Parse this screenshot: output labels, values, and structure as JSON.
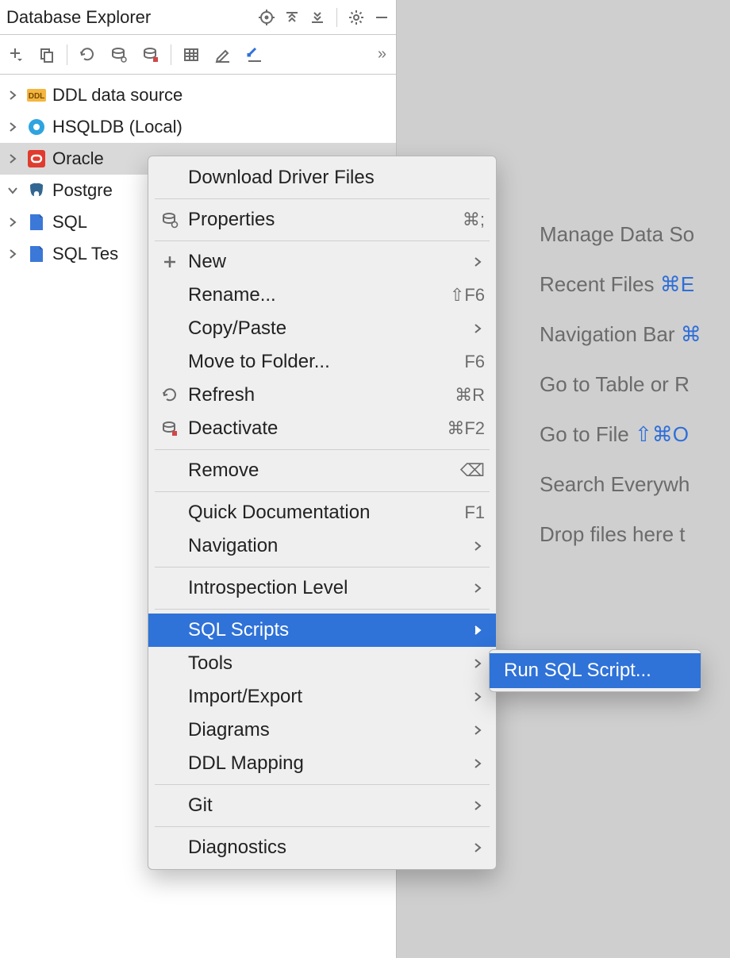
{
  "panel": {
    "title": "Database Explorer",
    "toolbar_more": "»"
  },
  "tree": {
    "items": [
      {
        "label": "DDL data source",
        "expanded": false,
        "selected": false,
        "icon": "ddl"
      },
      {
        "label": "HSQLDB (Local)",
        "expanded": false,
        "selected": false,
        "icon": "hsqldb"
      },
      {
        "label": "Oracle",
        "expanded": false,
        "selected": true,
        "icon": "oracle"
      },
      {
        "label": "Postgre",
        "expanded": true,
        "selected": false,
        "icon": "postgres"
      },
      {
        "label": "SQL",
        "expanded": false,
        "selected": false,
        "icon": "script"
      },
      {
        "label": "SQL Tes",
        "expanded": false,
        "selected": false,
        "icon": "script"
      }
    ]
  },
  "hints": {
    "manage": "Manage Data So",
    "recent": "Recent Files ",
    "recent_key": "⌘E",
    "navbar": "Navigation Bar ",
    "navbar_key": "⌘",
    "table": "Go to Table or R",
    "file": "Go to File ",
    "file_key": "⇧⌘O",
    "search": "Search Everywh",
    "drop": "Drop files here t"
  },
  "ctx": {
    "items": [
      {
        "label": "Download Driver Files",
        "icon": "",
        "shortcut": "",
        "sub": false
      },
      {
        "sep": true
      },
      {
        "label": "Properties",
        "icon": "props",
        "shortcut": "⌘;",
        "sub": false
      },
      {
        "sep": true
      },
      {
        "label": "New",
        "icon": "plus",
        "shortcut": "",
        "sub": true
      },
      {
        "label": "Rename...",
        "icon": "",
        "shortcut": "⇧F6",
        "sub": false
      },
      {
        "label": "Copy/Paste",
        "icon": "",
        "shortcut": "",
        "sub": true
      },
      {
        "label": "Move to Folder...",
        "icon": "",
        "shortcut": "F6",
        "sub": false
      },
      {
        "label": "Refresh",
        "icon": "refresh",
        "shortcut": "⌘R",
        "sub": false
      },
      {
        "label": "Deactivate",
        "icon": "deact",
        "shortcut": "⌘F2",
        "sub": false
      },
      {
        "sep": true
      },
      {
        "label": "Remove",
        "icon": "",
        "shortcut": "⌫",
        "sub": false
      },
      {
        "sep": true
      },
      {
        "label": "Quick Documentation",
        "icon": "",
        "shortcut": "F1",
        "sub": false
      },
      {
        "label": "Navigation",
        "icon": "",
        "shortcut": "",
        "sub": true
      },
      {
        "sep": true
      },
      {
        "label": "Introspection Level",
        "icon": "",
        "shortcut": "",
        "sub": true
      },
      {
        "sep": true
      },
      {
        "label": "SQL Scripts",
        "icon": "",
        "shortcut": "",
        "sub": true,
        "highlight": true
      },
      {
        "label": "Tools",
        "icon": "",
        "shortcut": "",
        "sub": true
      },
      {
        "label": "Import/Export",
        "icon": "",
        "shortcut": "",
        "sub": true
      },
      {
        "label": "Diagrams",
        "icon": "",
        "shortcut": "",
        "sub": true
      },
      {
        "label": "DDL Mapping",
        "icon": "",
        "shortcut": "",
        "sub": true
      },
      {
        "sep": true
      },
      {
        "label": "Git",
        "icon": "",
        "shortcut": "",
        "sub": true
      },
      {
        "sep": true
      },
      {
        "label": "Diagnostics",
        "icon": "",
        "shortcut": "",
        "sub": true
      }
    ]
  },
  "subctx": {
    "items": [
      {
        "label": "Run SQL Script...",
        "highlight": true
      }
    ]
  }
}
